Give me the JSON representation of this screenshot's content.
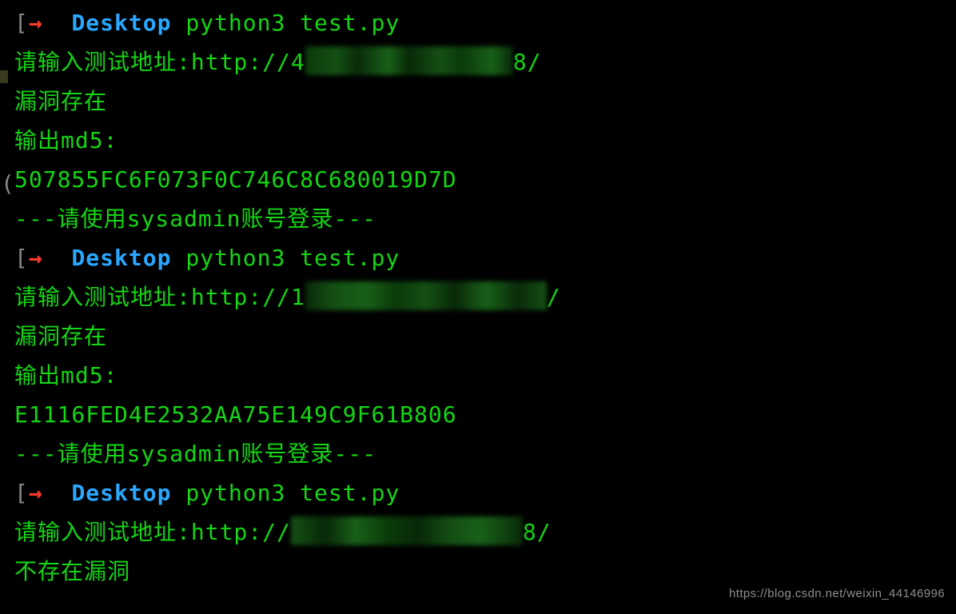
{
  "prompt": {
    "arrow": "→",
    "desktop": "Desktop",
    "command": "python3 test.py"
  },
  "runs": [
    {
      "input_prompt": "请输入测试地址:",
      "url_prefix": "http://4",
      "url_suffix": "8/",
      "vuln": "漏洞存在",
      "md5_label": "输出md5:",
      "md5": "507855FC6F073F0C746C8C680019D7D",
      "login_hint": "---请使用sysadmin账号登录---"
    },
    {
      "input_prompt": "请输入测试地址:",
      "url_prefix": "http://1",
      "url_suffix": "/",
      "vuln": "漏洞存在",
      "md5_label": "输出md5:",
      "md5": "E1116FED4E2532AA75E149C9F61B806",
      "login_hint": "---请使用sysadmin账号登录---"
    },
    {
      "input_prompt": "请输入测试地址:",
      "url_prefix": "http://",
      "url_suffix": "8/",
      "vuln_none": "不存在漏洞"
    }
  ],
  "watermark": "https://blog.csdn.net/weixin_44146996",
  "edge_markers": {
    "bracket_open": "[",
    "paren_open": "("
  }
}
